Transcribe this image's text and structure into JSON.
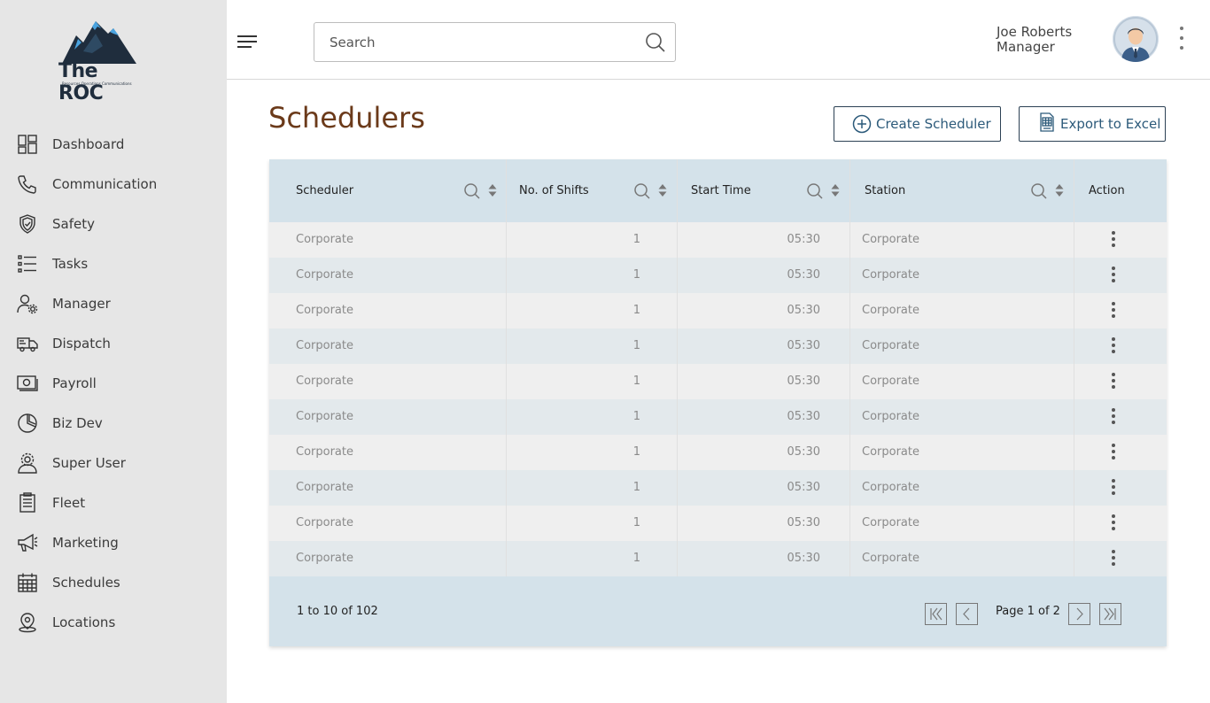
{
  "app": {
    "logo_text": "The ROC",
    "logo_sub": "Resources Operations Communications"
  },
  "sidebar": {
    "items": [
      {
        "label": "Dashboard",
        "icon": "dashboard-icon"
      },
      {
        "label": "Communication",
        "icon": "phone-icon"
      },
      {
        "label": "Safety",
        "icon": "shield-icon"
      },
      {
        "label": "Tasks",
        "icon": "list-icon"
      },
      {
        "label": "Manager",
        "icon": "user-gear-icon"
      },
      {
        "label": "Dispatch",
        "icon": "truck-icon"
      },
      {
        "label": "Payroll",
        "icon": "money-icon"
      },
      {
        "label": "Biz Dev",
        "icon": "pie-chart-icon"
      },
      {
        "label": "Super User",
        "icon": "user-cog-icon"
      },
      {
        "label": "Fleet",
        "icon": "clipboard-icon"
      },
      {
        "label": "Marketing",
        "icon": "megaphone-icon"
      },
      {
        "label": "Schedules",
        "icon": "calendar-icon"
      },
      {
        "label": "Locations",
        "icon": "location-pin-icon"
      }
    ]
  },
  "header": {
    "search_placeholder": "Search",
    "search_value": "",
    "user_name": "Joe Roberts",
    "user_role": "Manager"
  },
  "main": {
    "title": "Schedulers",
    "create_label": "Create Scheduler",
    "export_label": "Export to Excel"
  },
  "grid": {
    "columns": [
      "Scheduler",
      "No. of Shifts",
      "Start Time",
      "Station",
      "Action"
    ],
    "rows": [
      {
        "scheduler": "Corporate",
        "shifts": "1",
        "start": "05:30",
        "station": "Corporate"
      },
      {
        "scheduler": "Corporate",
        "shifts": "1",
        "start": "05:30",
        "station": "Corporate"
      },
      {
        "scheduler": "Corporate",
        "shifts": "1",
        "start": "05:30",
        "station": "Corporate"
      },
      {
        "scheduler": "Corporate",
        "shifts": "1",
        "start": "05:30",
        "station": "Corporate"
      },
      {
        "scheduler": "Corporate",
        "shifts": "1",
        "start": "05:30",
        "station": "Corporate"
      },
      {
        "scheduler": "Corporate",
        "shifts": "1",
        "start": "05:30",
        "station": "Corporate"
      },
      {
        "scheduler": "Corporate",
        "shifts": "1",
        "start": "05:30",
        "station": "Corporate"
      },
      {
        "scheduler": "Corporate",
        "shifts": "1",
        "start": "05:30",
        "station": "Corporate"
      },
      {
        "scheduler": "Corporate",
        "shifts": "1",
        "start": "05:30",
        "station": "Corporate"
      },
      {
        "scheduler": "Corporate",
        "shifts": "1",
        "start": "05:30",
        "station": "Corporate"
      }
    ],
    "summary": "1 to 10 of 102",
    "page_label": "Page 1 of 2"
  },
  "colors": {
    "title": "#6b3a1a",
    "accent": "#2c5a7a",
    "grid_header": "#d4e2ea",
    "sidebar_bg": "#e6e6e6"
  }
}
